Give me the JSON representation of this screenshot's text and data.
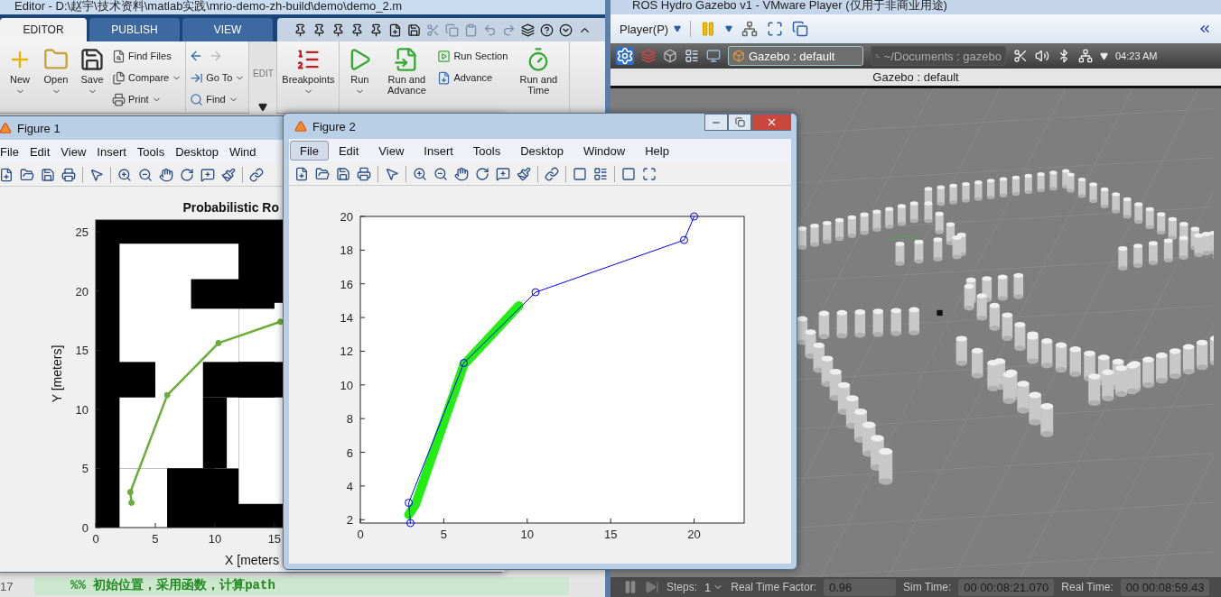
{
  "editor": {
    "title": "Editor - D:\\赵宇\\技术资料\\matlab实践\\mrio-demo-zh-build\\demo\\demo_2.m",
    "tabs": [
      {
        "label": "EDITOR",
        "selected": true
      },
      {
        "label": "PUBLISH",
        "selected": false
      },
      {
        "label": "VIEW",
        "selected": false
      }
    ],
    "toolstrip": [
      {
        "items": [
          {
            "kind": "large",
            "label": "New",
            "dropdown": true
          },
          {
            "kind": "large",
            "label": "Open",
            "dropdown": true
          },
          {
            "kind": "large",
            "label": "Save",
            "dropdown": true
          },
          {
            "kind": "small",
            "label": "Find Files",
            "dropdown": false
          },
          {
            "kind": "small",
            "label": "Compare",
            "dropdown": true
          },
          {
            "kind": "small",
            "label": "Print",
            "dropdown": true
          }
        ]
      },
      {
        "items": [
          {
            "kind": "nav_arrows"
          },
          {
            "kind": "small",
            "label": "Go To",
            "dropdown": true
          },
          {
            "kind": "small",
            "label": "Find",
            "dropdown": true
          }
        ]
      },
      {
        "items": [
          {
            "kind": "collapsed",
            "label": "EDIT"
          }
        ]
      },
      {
        "items": [
          {
            "kind": "large",
            "label": "Breakpoints",
            "dropdown": true
          }
        ]
      },
      {
        "items": [
          {
            "kind": "large",
            "label": "Run",
            "dropdown": true
          },
          {
            "kind": "large",
            "label": "Run and Advance",
            "dropdown": false
          },
          {
            "kind": "small",
            "label": "Run Section",
            "dropdown": false
          },
          {
            "kind": "small",
            "label": "Advance",
            "dropdown": false
          },
          {
            "kind": "large",
            "label": "Run and Time",
            "dropdown": false
          }
        ]
      }
    ],
    "code_lines": [
      {
        "number": "17",
        "text": "%% 初始位置，采用函数，计算path"
      }
    ]
  },
  "figure_1": {
    "title": "Figure 1",
    "menu": [
      {
        "label": "File",
        "selected": false
      },
      {
        "label": "Edit",
        "selected": false
      },
      {
        "label": "View",
        "selected": false
      },
      {
        "label": "Insert",
        "selected": false
      },
      {
        "label": "Tools",
        "selected": false
      },
      {
        "label": "Desktop",
        "selected": false
      },
      {
        "label": "Wind",
        "selected": false
      }
    ],
    "chart_data": {
      "type": "line",
      "title": "Probabilistic Ro",
      "xlabel": "X [meters",
      "ylabel": "Y [meters]",
      "xlim": [
        0,
        26
      ],
      "ylim": [
        0,
        26
      ],
      "xticks": [
        0,
        5,
        10,
        15
      ],
      "yticks": [
        0,
        5,
        10,
        15,
        20,
        25
      ],
      "series": [
        {
          "color": "#6aad37",
          "marker": "o",
          "x": [
            3,
            2.9,
            6,
            10.3,
            15.5
          ],
          "values": [
            2.1,
            3,
            11.2,
            15.6,
            17.4
          ]
        }
      ]
    }
  },
  "figure_2": {
    "title": "Figure 2",
    "menu": [
      {
        "label": "File",
        "selected": true
      },
      {
        "label": "Edit",
        "selected": false
      },
      {
        "label": "View",
        "selected": false
      },
      {
        "label": "Insert",
        "selected": false
      },
      {
        "label": "Tools",
        "selected": false
      },
      {
        "label": "Desktop",
        "selected": false
      },
      {
        "label": "Window",
        "selected": false
      },
      {
        "label": "Help",
        "selected": false
      }
    ],
    "chart_data": {
      "type": "line",
      "xlim": [
        0,
        23
      ],
      "ylim": [
        1.8,
        20
      ],
      "xticks": [
        0,
        5,
        10,
        15,
        20
      ],
      "yticks": [
        2,
        4,
        6,
        8,
        10,
        12,
        14,
        16,
        18,
        20
      ],
      "series": [
        {
          "color": "#22ee11",
          "x": [
            2.9,
            3.3,
            6.2,
            9.5
          ],
          "values": [
            2.3,
            2.9,
            11.2,
            14.7
          ]
        },
        {
          "color": "#0000ff",
          "marker": "o",
          "x": [
            3,
            2.9,
            6.2,
            10.5,
            19.4,
            20
          ],
          "values": [
            1.8,
            3,
            11.3,
            15.5,
            18.6,
            20
          ]
        }
      ]
    }
  },
  "vmware": {
    "title": "ROS Hydro Gazebo v1 - VMware Player (仅用于非商业用途)",
    "player_menu": "Player(P)",
    "tasks": [
      {
        "label": "Gazebo : default",
        "selected": true
      },
      {
        "label": "~/Documents : gazebo",
        "selected": false
      }
    ],
    "clock": "04:23 AM",
    "window_title": "Gazebo : default",
    "status": {
      "steps_label": "Steps:",
      "steps": "1",
      "rtf_label": "Real Time Factor:",
      "rtf": "0.96",
      "sim_label": "Sim Time:",
      "sim": "00 00:08:21.070",
      "real_label": "Real Time:",
      "real": "00 00:08:59.43"
    }
  }
}
